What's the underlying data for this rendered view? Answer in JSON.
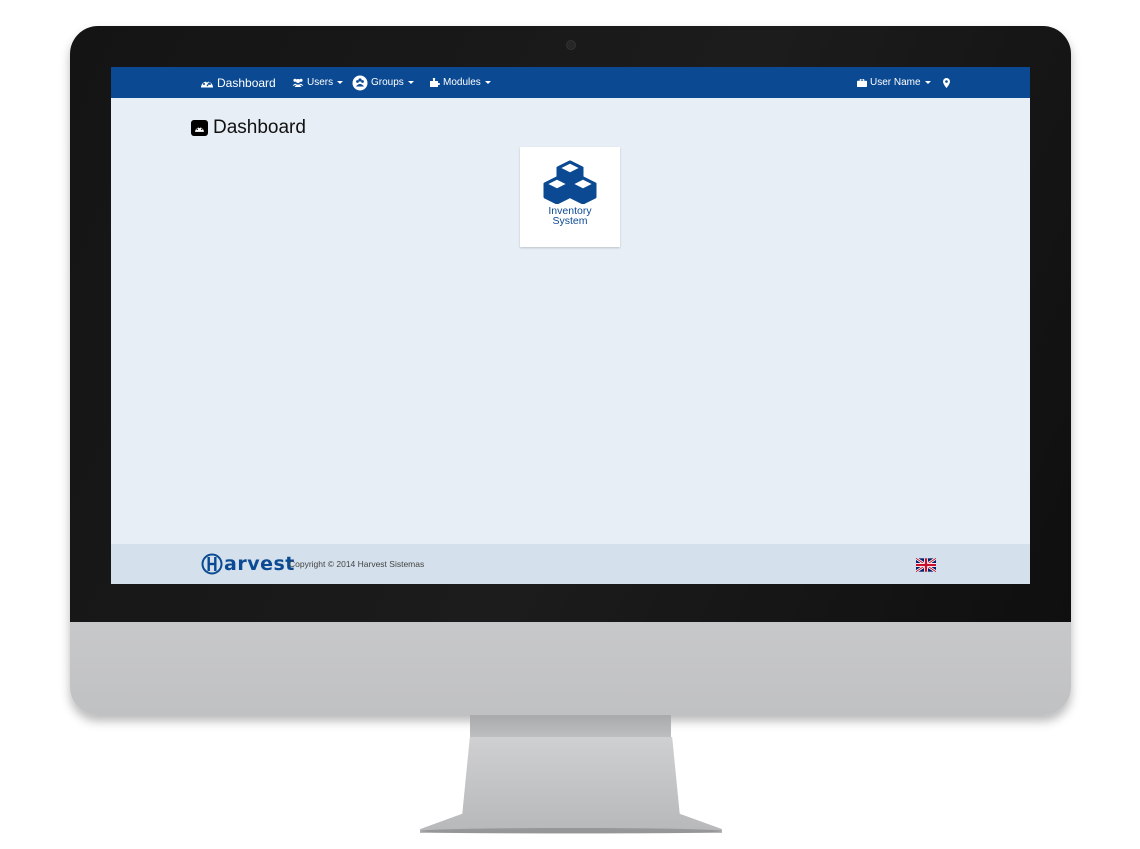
{
  "navbar": {
    "dashboard_label": "Dashboard",
    "users_label": "Users",
    "groups_label": "Groups",
    "modules_label": "Modules",
    "user_name_label": "User Name",
    "bg_color": "#0b4a93"
  },
  "page": {
    "title": "Dashboard"
  },
  "tiles": [
    {
      "label": "Inventory\nSystem",
      "icon": "cubes-icon"
    }
  ],
  "footer": {
    "logo_text": "arvest",
    "logo_icon": "harvest-h-icon",
    "copyright": "Copyright © 2014 Harvest Sistemas",
    "language_icon": "uk-flag-icon"
  },
  "colors": {
    "accent": "#0b4a93",
    "content_bg": "#e7eef6",
    "footer_bg": "#d4e0eb"
  }
}
